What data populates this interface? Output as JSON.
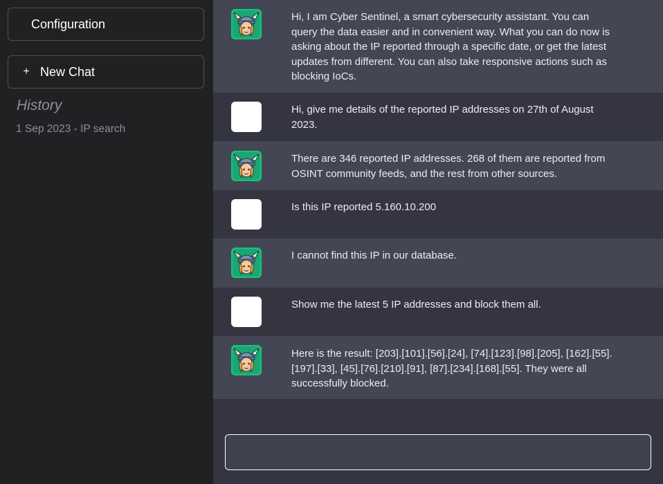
{
  "sidebar": {
    "config_label": "Configuration",
    "new_chat_icon": "+",
    "new_chat_label": "New Chat",
    "history_title": "History",
    "history_items": [
      "1 Sep 2023 - IP search"
    ]
  },
  "messages": [
    {
      "role": "bot",
      "text": "Hi, I am Cyber Sentinel, a smart cybersecurity assistant. You can query the data easier and in convenient way. What you can do now is asking about the IP reported through a specific date, or get the latest updates from different. You can also take responsive actions such as blocking IoCs."
    },
    {
      "role": "user",
      "text": "Hi, give me details of the reported IP addresses on 27th of August 2023."
    },
    {
      "role": "bot",
      "text": "There are 346 reported IP addresses. 268 of them are reported from OSINT community feeds, and the rest from other sources."
    },
    {
      "role": "user",
      "text": "Is this IP reported 5.160.10.200"
    },
    {
      "role": "bot",
      "text": "I cannot find this IP in our database."
    },
    {
      "role": "user",
      "text": "Show me the latest 5 IP addresses and block them all."
    },
    {
      "role": "bot",
      "text": "Here is the result: [203].[101].[56].[24], [74].[123].[98].[205], [162].[55].[197].[33], [45].[76].[210].[91], [87].[234].[168].[55]. They were all successfully blocked."
    }
  ],
  "input": {
    "value": "",
    "placeholder": ""
  },
  "icons": {
    "bot_avatar": "viking-bot-avatar-icon",
    "user_avatar": "user-avatar-icon"
  },
  "colors": {
    "sidebar_bg": "#202123",
    "chat_bg": "#343541",
    "bot_row_bg": "#444654",
    "bot_avatar_bg": "#19c37d"
  }
}
